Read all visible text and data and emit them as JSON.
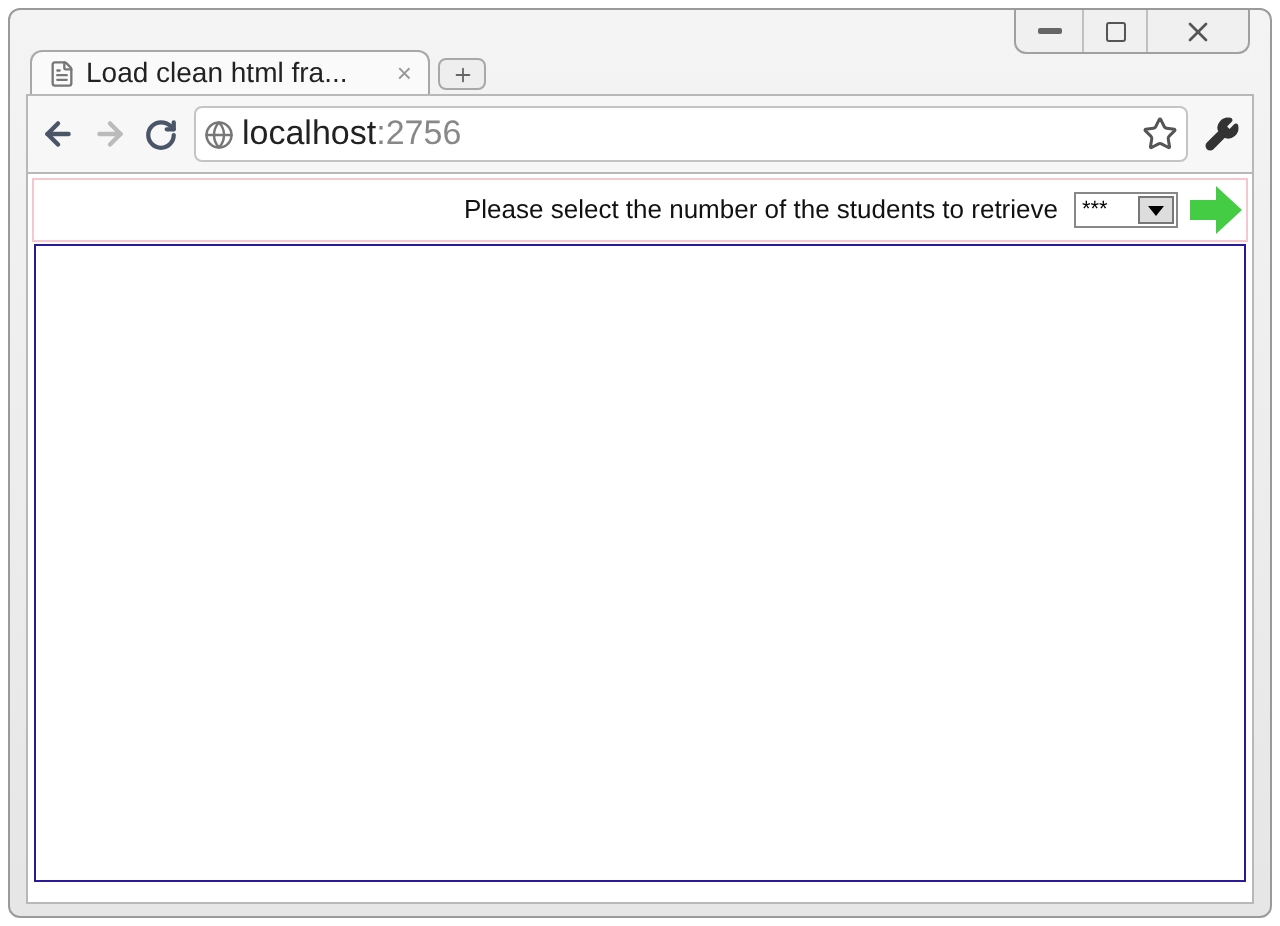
{
  "tab": {
    "title": "Load clean html fra...",
    "close": "×"
  },
  "address": {
    "host": "localhost",
    "port": ":2756"
  },
  "page": {
    "prompt": "Please select the number of the students to retrieve",
    "select_value": "***"
  }
}
